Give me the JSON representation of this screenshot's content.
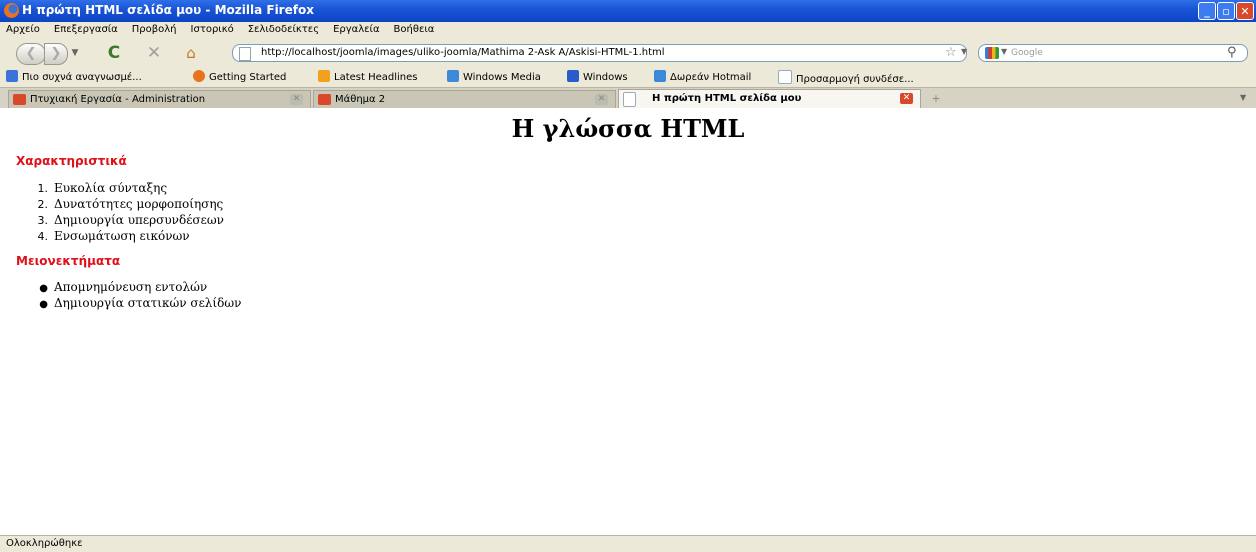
{
  "window": {
    "title": "Η πρώτη HTML σελίδα μου - Mozilla Firefox"
  },
  "menu": [
    "Αρχείο",
    "Επεξεργασία",
    "Προβολή",
    "Ιστορικό",
    "Σελιδοδείκτες",
    "Εργαλεία",
    "Βοήθεια"
  ],
  "toolbar": {
    "url": "http://localhost/joomla/images/uliko-joomla/Mathima 2-Ask A/Askisi-HTML-1.html",
    "search_placeholder": "Google"
  },
  "bookmarks": [
    {
      "label": "Πιο συχνά αναγνωσμέ...",
      "icon": "rss-icon",
      "color": "#3b73d8"
    },
    {
      "label": "Getting Started",
      "icon": "firefox-icon",
      "color": "#e8731c"
    },
    {
      "label": "Latest Headlines",
      "icon": "feed-icon",
      "color": "#f2a11c"
    },
    {
      "label": "Windows Media",
      "icon": "msn-icon",
      "color": "#3a8ad8"
    },
    {
      "label": "Windows",
      "icon": "windows-icon",
      "color": "#2a5bc8"
    },
    {
      "label": "Δωρεάν Hotmail",
      "icon": "msn-icon",
      "color": "#3a8ad8"
    },
    {
      "label": "Προσαρμογή συνδέσε...",
      "icon": "page-icon",
      "color": "#9ab"
    }
  ],
  "tabs": [
    {
      "label": "Πτυχιακή Εργασία - Administration",
      "active": false
    },
    {
      "label": "Μάθημα 2",
      "active": false
    },
    {
      "label": "Η πρώτη HTML σελίδα μου",
      "active": true
    }
  ],
  "content": {
    "heading": "Η γλώσσα HTML",
    "section1": "Χαρακτηριστικά",
    "ordered": [
      {
        "n": "1.",
        "text": "Ευκολία σύνταξης"
      },
      {
        "n": "2.",
        "text": "Δυνατότητες μορφοποίησης"
      },
      {
        "n": "3.",
        "text": "Δημιουργία υπερσυνδέσεων"
      },
      {
        "n": "4.",
        "text": "Ενσωμάτωση εικόνων"
      }
    ],
    "section2": "Μειονεκτήματα",
    "unordered": [
      "Απομνημόνευση εντολών",
      "Δημιουργία στατικών σελίδων"
    ]
  },
  "status": "Ολοκληρώθηκε"
}
